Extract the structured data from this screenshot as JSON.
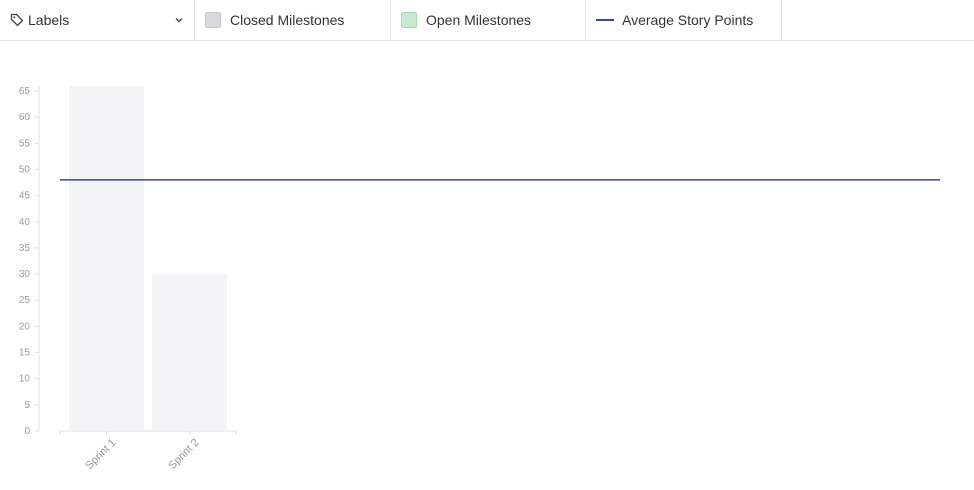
{
  "toolbar": {
    "labels_dropdown": "Labels",
    "legend": {
      "closed": "Closed Milestones",
      "open": "Open Milestones",
      "average": "Average Story Points"
    }
  },
  "colors": {
    "closed_fill": "#d9d9de",
    "closed_border": "#c4c4ca",
    "open_fill": "#c6ead0",
    "open_border": "#a8dbb6",
    "bar": "#f3f3f5",
    "average_line": "#3d4a8a",
    "axis": "#dddddd",
    "tick_label": "#9a9a9a"
  },
  "chart_data": {
    "type": "bar",
    "categories": [
      "Sprint 1",
      "Sprint 2"
    ],
    "series": [
      {
        "values": [
          66,
          30
        ]
      }
    ],
    "average_line": 48,
    "yticks": [
      0,
      5,
      10,
      15,
      20,
      25,
      30,
      35,
      40,
      45,
      50,
      55,
      60,
      65
    ],
    "ylim": [
      0,
      65
    ],
    "grid": false,
    "legend_position": "top"
  }
}
